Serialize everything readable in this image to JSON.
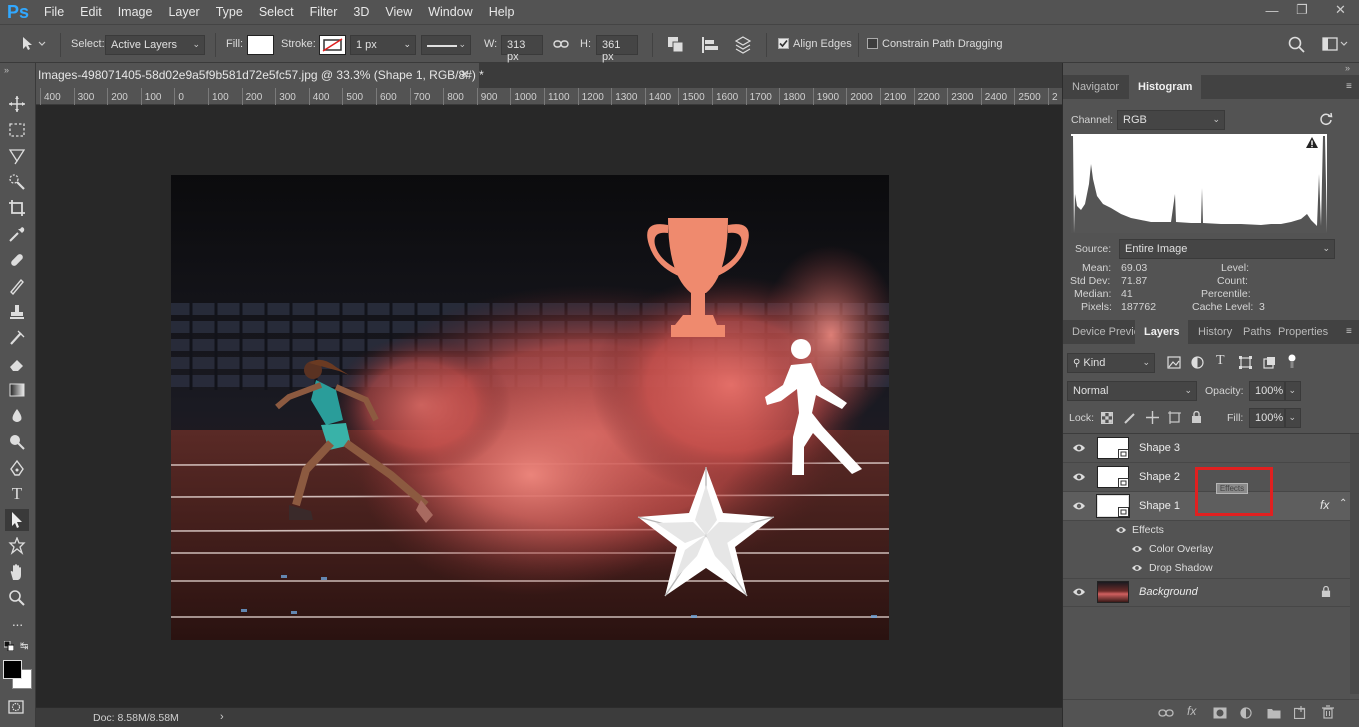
{
  "app": {
    "logo": "Ps"
  },
  "menu": [
    "File",
    "Edit",
    "Image",
    "Layer",
    "Type",
    "Select",
    "Filter",
    "3D",
    "View",
    "Window",
    "Help"
  ],
  "window_controls": {
    "minimize": "minimize-icon",
    "restore": "restore-icon",
    "close": "close-icon"
  },
  "options": {
    "select_label": "Select:",
    "select_value": "Active Layers",
    "fill_label": "Fill:",
    "stroke_label": "Stroke:",
    "stroke_width": "1 px",
    "w_label": "W:",
    "w_value": "313 px",
    "h_label": "H:",
    "h_value": "361 px",
    "align_edges": "Align Edges",
    "align_edges_checked": true,
    "constrain": "Constrain Path Dragging",
    "constrain_checked": false
  },
  "document": {
    "tab_title": "Images-498071405-58d02e9a5f9b581d72e5fc57.jpg @ 33.3% (Shape 1, RGB/8#) *",
    "ruler_ticks": [
      "400",
      "300",
      "200",
      "100",
      "0",
      "100",
      "200",
      "300",
      "400",
      "500",
      "600",
      "700",
      "800",
      "900",
      "1000",
      "1100",
      "1200",
      "1300",
      "1400",
      "1500",
      "1600",
      "1700",
      "1800",
      "1900",
      "2000",
      "2100",
      "2200",
      "2300",
      "2400",
      "2500",
      "2"
    ],
    "status": "Doc: 8.58M/8.58M"
  },
  "histogram": {
    "tabs": [
      "Navigator",
      "Histogram"
    ],
    "active_tab": "Histogram",
    "channel_label": "Channel:",
    "channel_value": "RGB",
    "source_label": "Source:",
    "source_value": "Entire Image",
    "stats": {
      "mean_label": "Mean:",
      "mean": "69.03",
      "stddev_label": "Std Dev:",
      "stddev": "71.87",
      "median_label": "Median:",
      "median": "41",
      "pixels_label": "Pixels:",
      "pixels": "187762",
      "level_label": "Level:",
      "level": "",
      "count_label": "Count:",
      "count": "",
      "percentile_label": "Percentile:",
      "percentile": "",
      "cache_label": "Cache Level:",
      "cache": "3"
    }
  },
  "layers_panel": {
    "tabs": [
      "Device Previe",
      "Layers",
      "History",
      "Paths",
      "Properties"
    ],
    "active_tab": "Layers",
    "kind_label": "Kind",
    "blend_mode": "Normal",
    "opacity_label": "Opacity:",
    "opacity": "100%",
    "lock_label": "Lock:",
    "fill_label": "Fill:",
    "fill": "100%",
    "layers": [
      {
        "name": "Shape 3"
      },
      {
        "name": "Shape 2"
      },
      {
        "name": "Shape 1",
        "fx": "fx"
      }
    ],
    "effects_label": "Effects",
    "effects": [
      "Color Overlay",
      "Drop Shadow"
    ],
    "background_layer": "Background",
    "drag_tooltip": "Effects"
  },
  "colors": {
    "accent": "#31a8ff",
    "highlight_box": "#e02020",
    "trophy": "#ef8a6e"
  }
}
